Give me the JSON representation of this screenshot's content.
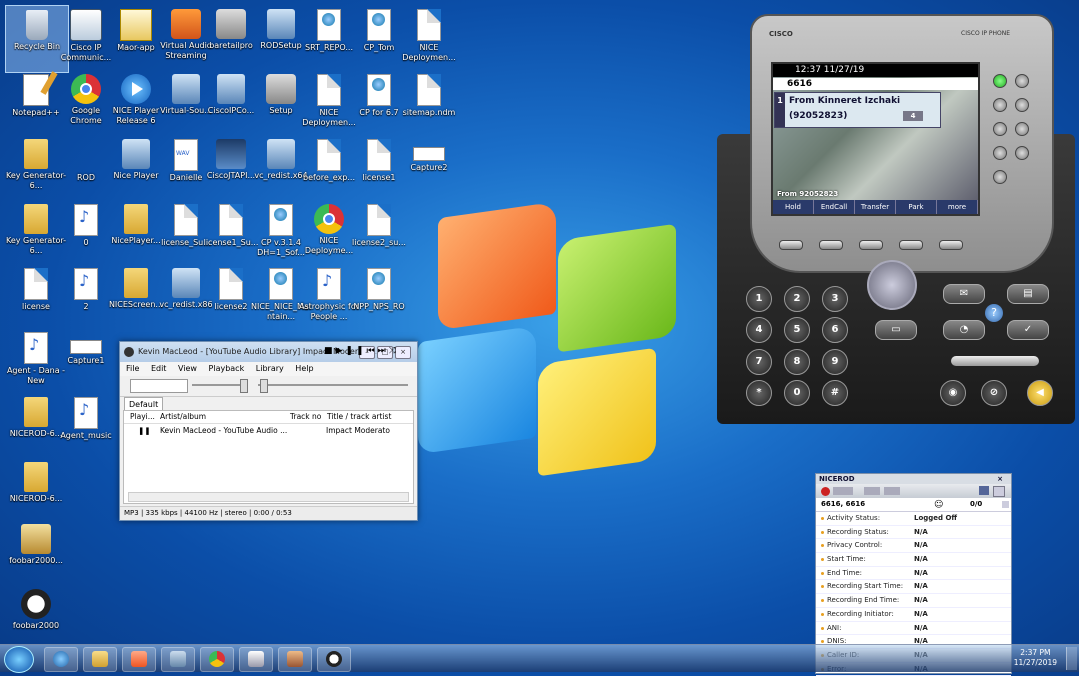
{
  "desktop": {
    "icons": [
      {
        "label": "Recycle Bin",
        "icon": "bin"
      },
      {
        "label": "Cisco IP Communic...",
        "icon": "cisco"
      },
      {
        "label": "Maor-app",
        "icon": "cert"
      },
      {
        "label": "Virtual Audio Streaming",
        "icon": "speaker"
      },
      {
        "label": "baretailpro",
        "icon": "gear"
      },
      {
        "label": "RODSetup",
        "icon": "setup"
      },
      {
        "label": "SRT_REPO...",
        "icon": "globe"
      },
      {
        "label": "CP_Tom",
        "icon": "globe"
      },
      {
        "label": "NICE Deploymen...",
        "icon": "doc"
      },
      {
        "label": "Notepad++",
        "icon": "notepad"
      },
      {
        "label": "Google Chrome",
        "icon": "chrome"
      },
      {
        "label": "NICE Player Release 6",
        "icon": "player"
      },
      {
        "label": "Virtual-Sou...",
        "icon": "setup"
      },
      {
        "label": "CiscoIPCo...",
        "icon": "setup"
      },
      {
        "label": "Setup",
        "icon": "gear"
      },
      {
        "label": "NICE Deploymen...",
        "icon": "doc"
      },
      {
        "label": "CP for 6.7",
        "icon": "globe"
      },
      {
        "label": "sitemap.ndm",
        "icon": "doc"
      },
      {
        "label": "Key Generator-6...",
        "icon": "folder"
      },
      {
        "label": "ROD",
        "icon": "rod"
      },
      {
        "label": "Nice Player",
        "icon": "setup"
      },
      {
        "label": "Danielle",
        "icon": "wav"
      },
      {
        "label": "CiscoJTAPI...",
        "icon": "sail"
      },
      {
        "label": "vc_redist.x64",
        "icon": "setup"
      },
      {
        "label": "before_exp...",
        "icon": "doc"
      },
      {
        "label": "license1",
        "icon": "doc"
      },
      {
        "label": "Capture2",
        "icon": "cap"
      },
      {
        "label": "Key Generator-6...",
        "icon": "folder"
      },
      {
        "label": "0",
        "icon": "mp3"
      },
      {
        "label": "NicePlayer...",
        "icon": "folder"
      },
      {
        "label": "license_Su...",
        "icon": "doc"
      },
      {
        "label": "license1_Su...",
        "icon": "doc"
      },
      {
        "label": "CP v.3.1.4 DH=1_Sof...",
        "icon": "globe"
      },
      {
        "label": "NICE Deployme...",
        "icon": "chrome"
      },
      {
        "label": "license2_su...",
        "icon": "doc"
      },
      {
        "label": "license",
        "icon": "doc"
      },
      {
        "label": "2",
        "icon": "mp3"
      },
      {
        "label": "NICEScreen...",
        "icon": "folder"
      },
      {
        "label": "vc_redist.x86",
        "icon": "setup"
      },
      {
        "label": "license2",
        "icon": "doc"
      },
      {
        "label": "NICE_NICE_Maintain...",
        "icon": "globe"
      },
      {
        "label": "Astrophysic for People ...",
        "icon": "mp3"
      },
      {
        "label": "NPP_NPS_RO",
        "icon": "globe"
      },
      {
        "label": "Agent - Dana - New",
        "icon": "mp3"
      },
      {
        "label": "Capture1",
        "icon": "cap"
      },
      {
        "label": "NICEROD-6...",
        "icon": "folder"
      },
      {
        "label": "Agent_music",
        "icon": "mp3"
      },
      {
        "label": "NICEROD-6...",
        "icon": "folder"
      },
      {
        "label": "foobar2000...",
        "icon": "foobar"
      },
      {
        "label": "foobar2000",
        "icon": "fox"
      }
    ]
  },
  "player": {
    "title": "Kevin MacLeod - [YouTube Audio Library] Impact Moderato...",
    "menu": [
      "File",
      "Edit",
      "View",
      "Playback",
      "Library",
      "Help"
    ],
    "tab": "Default",
    "columns": [
      "Playi...",
      "Artist/album",
      "Track no",
      "Title / track artist"
    ],
    "rows": [
      {
        "artist": "Kevin MacLeod - YouTube Audio ...",
        "title": "Impact Moderato"
      }
    ],
    "status": "MP3 | 335 kbps | 44100 Hz | stereo | 0:00 / 0:53"
  },
  "phone": {
    "brand": "CISCO",
    "model": "CISCO IP PHONE",
    "datetime": "12:37 11/27/19",
    "line": "6616",
    "call_line_no": "1",
    "call_from": "From Kinneret Izchaki",
    "call_number": "(92052823)",
    "call_count": "4",
    "status": "From 92052823",
    "softkeys": [
      "Hold",
      "EndCall",
      "Transfer",
      "Park",
      "more"
    ],
    "keypad": [
      "1",
      "2",
      "3",
      "4",
      "5",
      "6",
      "7",
      "8",
      "9",
      "*",
      "0",
      "#"
    ]
  },
  "rod": {
    "title": "NICEROD",
    "extension": "6616, 6616",
    "counter": "0/0",
    "fields": [
      {
        "key": "Activity Status:",
        "value": "Logged Off"
      },
      {
        "key": "Recording Status:",
        "value": "N/A"
      },
      {
        "key": "Privacy Control:",
        "value": "N/A"
      },
      {
        "key": "Start Time:",
        "value": "N/A"
      },
      {
        "key": "End Time:",
        "value": "N/A"
      },
      {
        "key": "Recording Start Time:",
        "value": "N/A"
      },
      {
        "key": "Recording End Time:",
        "value": "N/A"
      },
      {
        "key": "Recording Initiator:",
        "value": "N/A"
      },
      {
        "key": "ANI:",
        "value": "N/A"
      },
      {
        "key": "DNIS:",
        "value": "N/A"
      },
      {
        "key": "Caller ID:",
        "value": "N/A"
      },
      {
        "key": "Error:",
        "value": "N/A"
      }
    ]
  },
  "taskbar": {
    "time": "2:37 PM",
    "date": "11/27/2019",
    "apps": [
      "ie-icon",
      "explorer-icon",
      "media-player-icon",
      "setup-icon",
      "chrome-icon",
      "cisco-icon",
      "baretail-icon",
      "foobar-icon"
    ]
  }
}
